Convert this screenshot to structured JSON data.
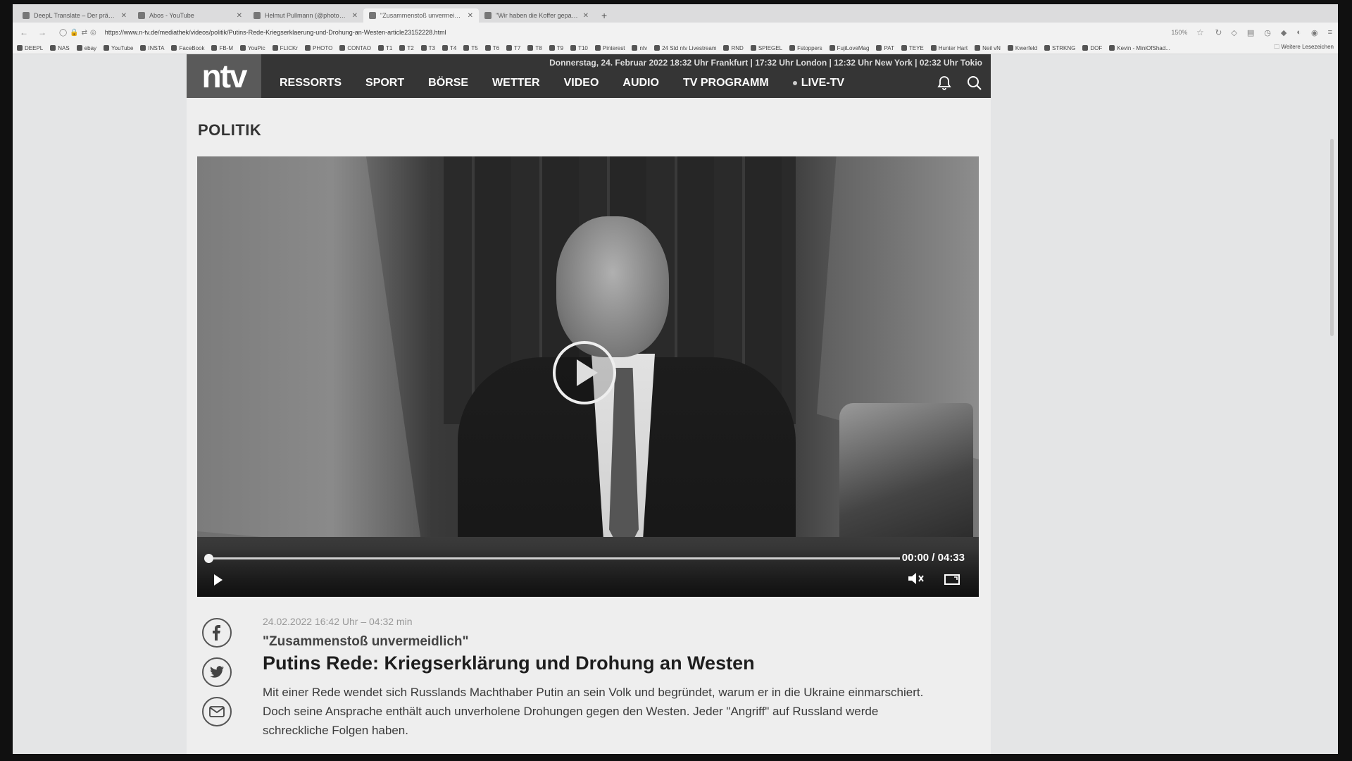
{
  "browser": {
    "tabs": [
      {
        "label": "DeepL Translate – Der präziseste",
        "active": false
      },
      {
        "label": "Abos - YouTube",
        "active": false
      },
      {
        "label": "Helmut Pullmann (@photohp)",
        "active": false
      },
      {
        "label": "\"Zusammenstoß unvermeidlich\"",
        "active": true
      },
      {
        "label": "\"Wir haben die Koffer gepackt\"",
        "active": false
      }
    ],
    "new_tab": "+",
    "url": "https://www.n-tv.de/mediathek/videos/politik/Putins-Rede-Kriegserklaerung-und-Drohung-an-Westen-article23152228.html",
    "zoom": "150%",
    "bookmarks": [
      "DEEPL",
      "NAS",
      "ebay",
      "YouTube",
      "INSTA",
      "FaceBook",
      "FB-M",
      "YouPic",
      "FLICKr",
      "PHOTO",
      "CONTAO",
      "T1",
      "T2",
      "T3",
      "T4",
      "T5",
      "T6",
      "T7",
      "T8",
      "T9",
      "T10",
      "Pinterest",
      "ntv",
      "24 Std ntv Livestream",
      "RND",
      "SPIEGEL",
      "Fstoppers",
      "FujiLoveMag",
      "PAT",
      "TEYE",
      "Hunter Hart",
      "Neil vN",
      "Kwerfeld",
      "STRKNG",
      "DOF",
      "Kevin - MiniOfShad..."
    ],
    "bookmarks_more": "Weitere Lesezeichen"
  },
  "site": {
    "logo": "ntv",
    "dateline": "Donnerstag, 24. Februar 2022 18:32 Uhr Frankfurt | 17:32 Uhr London | 12:32 Uhr New York | 02:32 Uhr Tokio",
    "nav": [
      "RESSORTS",
      "SPORT",
      "BÖRSE",
      "WETTER",
      "VIDEO",
      "AUDIO",
      "TV PROGRAMM"
    ],
    "nav_live": "LIVE-TV",
    "icons": {
      "notifications": "bell-icon",
      "search": "search-icon"
    }
  },
  "article": {
    "section": "POLITIK",
    "video": {
      "current": "00:00",
      "duration": "04:33",
      "timecode": "00:00 / 04:33",
      "progress": 0.0
    },
    "meta": "24.02.2022 16:42 Uhr – 04:32 min",
    "kicker": "\"Zusammenstoß unvermeidlich\"",
    "headline": "Putins Rede: Kriegserklärung und Drohung an Westen",
    "teaser": "Mit einer Rede wendet sich Russlands Machthaber Putin an sein Volk und begründet, warum er in die Ukraine einmarschiert. Doch seine Ansprache enthält auch unverholene Drohungen gegen den Westen. Jeder \"Angriff\" auf Russland werde schreckliche Folgen haben.",
    "share": [
      "facebook-icon",
      "twitter-icon",
      "mail-icon"
    ]
  }
}
